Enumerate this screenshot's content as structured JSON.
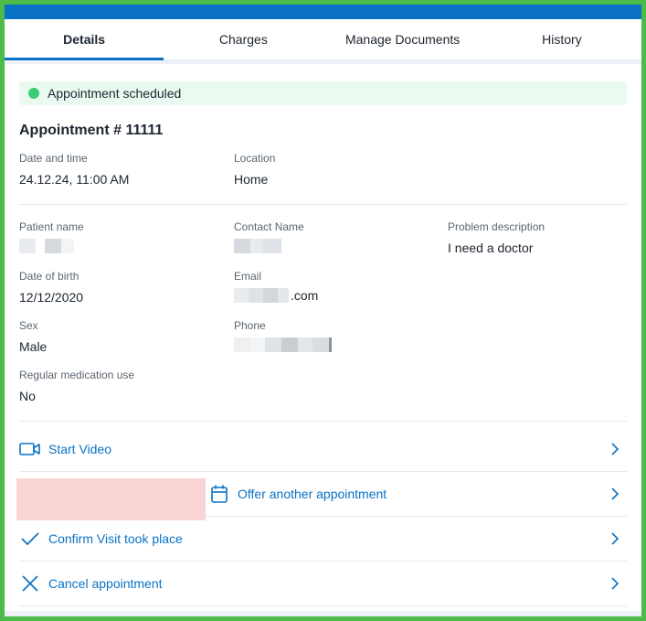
{
  "tabs": [
    {
      "label": "Details",
      "active": true
    },
    {
      "label": "Charges",
      "active": false
    },
    {
      "label": "Manage Documents",
      "active": false
    },
    {
      "label": "History",
      "active": false
    }
  ],
  "status": {
    "text": "Appointment scheduled",
    "color": "#3ccd72"
  },
  "appointment": {
    "title": "Appointment # 11111"
  },
  "details": {
    "date_label": "Date and time",
    "date_value": "24.12.24, 11:00 AM",
    "location_label": "Location",
    "location_value": "Home"
  },
  "patient": {
    "name_label": "Patient name",
    "contact_label": "Contact Name",
    "problem_label": "Problem description",
    "problem_value": "I need a doctor",
    "dob_label": "Date of birth",
    "dob_value": "12/12/2020",
    "email_label": "Email",
    "email_suffix": ".com",
    "sex_label": "Sex",
    "sex_value": "Male",
    "phone_label": "Phone",
    "medication_label": "Regular medication use",
    "medication_value": "No"
  },
  "actions": [
    {
      "label": "Start Video",
      "icon": "video-camera-icon"
    },
    {
      "label": "Offer another appointment",
      "icon": "calendar-icon"
    },
    {
      "label": "Confirm Visit took place",
      "icon": "checkmark-icon"
    },
    {
      "label": "Cancel appointment",
      "icon": "close-icon"
    }
  ],
  "colors": {
    "accent": "#0a72c4",
    "frame": "#4cbb49",
    "banner_bg": "#eafaf1",
    "highlight": "#fad3d5"
  }
}
